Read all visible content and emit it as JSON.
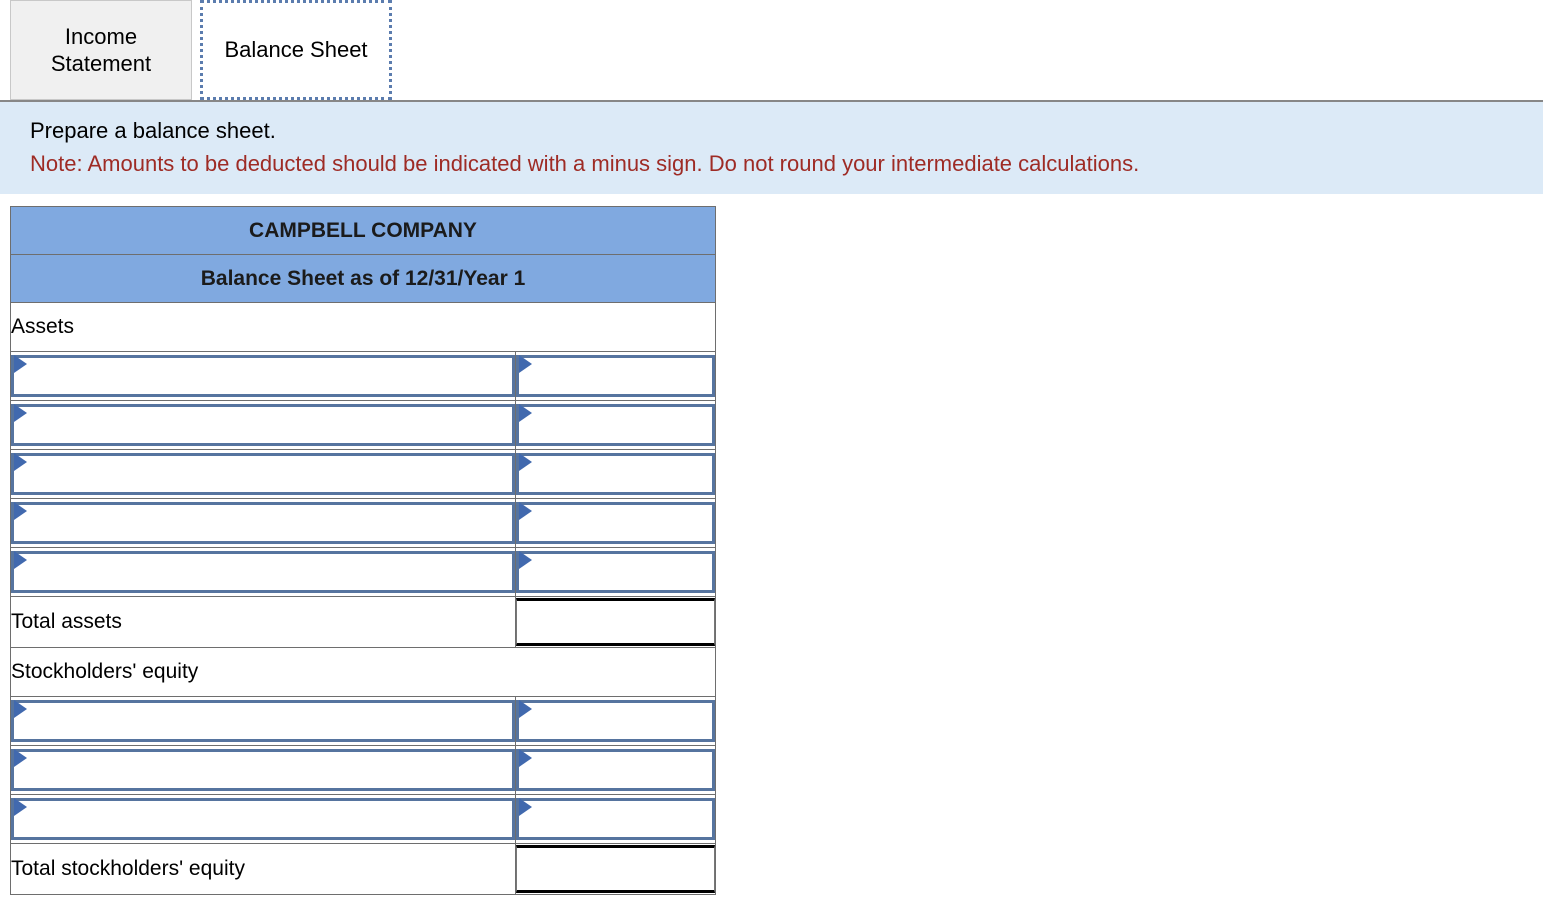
{
  "tabs": [
    {
      "label": "Income Statement",
      "name": "tab-income-statement",
      "active": false
    },
    {
      "label": "Balance Sheet",
      "name": "tab-balance-sheet",
      "active": true
    }
  ],
  "banner": {
    "instruction": "Prepare a balance sheet.",
    "note": "Note: Amounts to be deducted should be indicated with a minus sign. Do not round your intermediate calculations.",
    "background_color": "#dceaf7",
    "note_color": "#9e2b25"
  },
  "sheet": {
    "company": "CAMPBELL COMPANY",
    "subtitle": "Balance Sheet as of 12/31/Year 1",
    "header_color": "#80a9e0",
    "input_border_color": "#56749f",
    "caret_color": "#4169ae",
    "sections": [
      {
        "title": "Assets",
        "rows": [
          {
            "label_value": "",
            "amount_value": ""
          },
          {
            "label_value": "",
            "amount_value": ""
          },
          {
            "label_value": "",
            "amount_value": ""
          },
          {
            "label_value": "",
            "amount_value": ""
          },
          {
            "label_value": "",
            "amount_value": ""
          }
        ],
        "total_label": "Total assets",
        "total_value": ""
      },
      {
        "title": "Stockholders' equity",
        "rows": [
          {
            "label_value": "",
            "amount_value": ""
          },
          {
            "label_value": "",
            "amount_value": ""
          },
          {
            "label_value": "",
            "amount_value": ""
          }
        ],
        "total_label": "Total stockholders' equity",
        "total_value": ""
      }
    ]
  }
}
